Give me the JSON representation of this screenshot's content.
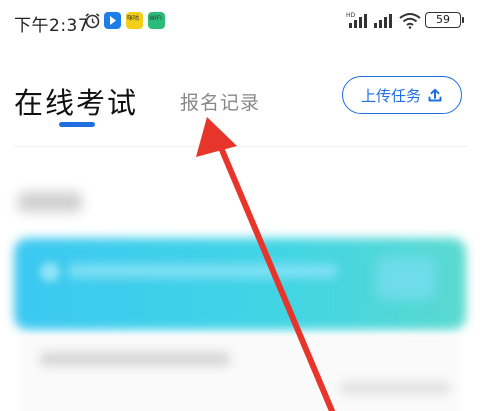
{
  "status_bar": {
    "time": "下午2:37",
    "app_icon_yellow_text": "咪咕",
    "app_icon_green_text": "WIFI",
    "battery": "59"
  },
  "tabs": {
    "active": "在线考试",
    "inactive": "报名记录"
  },
  "upload_button": {
    "label": "上传任务"
  },
  "colors": {
    "accent": "#1f6fe0",
    "annotation": "#e8352c",
    "card": "#3cc8f2"
  }
}
